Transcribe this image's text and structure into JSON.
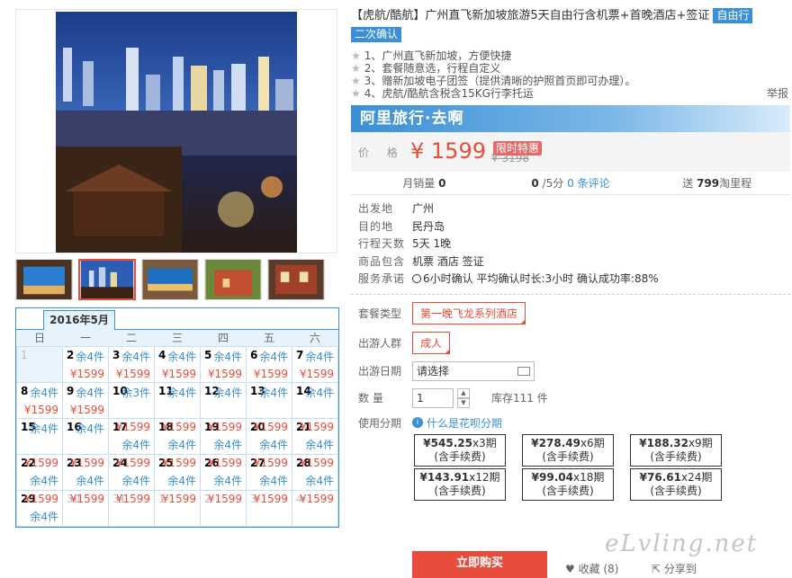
{
  "title": "【虎航/酷航】广州直飞新加坡旅游5天自由行含机票+首晚酒店+签证",
  "tag_free": "自由行",
  "tag_confirm": "二次确认",
  "features": [
    "1、广州直飞新加坡，方便快捷",
    "2、套餐随意选，行程自定义",
    "3、赠新加坡电子团签（提供清晰的护照首页即可办理）。",
    "4、虎航/酷航含税含15KG行李托运"
  ],
  "report": "举报",
  "brand": "阿里旅行·去啊",
  "price_label": "价 格",
  "price": "¥ 1599",
  "old_price": "¥ 3198",
  "special": "限时特惠",
  "stats": {
    "sales_label": "月销量",
    "sales": "0",
    "score": "0",
    "score_suffix": "/5分",
    "reviews": "0 条评论",
    "points_prefix": "送",
    "points": "799",
    "points_suffix": "淘里程"
  },
  "info": [
    {
      "k": "出发地",
      "v": "广州"
    },
    {
      "k": "目的地",
      "v": "民丹岛"
    },
    {
      "k": "行程天数",
      "v": "5天 1晚"
    },
    {
      "k": "商品包含",
      "v": "机票  酒店  签证"
    },
    {
      "k": "服务承诺",
      "v": "6小时确认   平均确认时长:3小时   确认成功率:88%"
    }
  ],
  "options": {
    "package_label": "套餐类型",
    "package": "第一晚飞龙系列酒店",
    "group_label": "出游人群",
    "group": "成人",
    "date_label": "出游日期",
    "date_placeholder": "请选择",
    "qty_label": "数  量",
    "qty": "1",
    "stock": "库存111 件",
    "install_label": "使用分期",
    "install_link": "什么是花呗分期"
  },
  "installments": [
    {
      "amt": "¥545.25",
      "n": "x3期",
      "fee": "(含手续费)"
    },
    {
      "amt": "¥278.49",
      "n": "x6期",
      "fee": "(含手续费)"
    },
    {
      "amt": "¥188.32",
      "n": "x9期",
      "fee": "(含手续费)"
    },
    {
      "amt": "¥143.91",
      "n": "x12期",
      "fee": "(含手续费)"
    },
    {
      "amt": "¥99.04",
      "n": "x18期",
      "fee": "(含手续费)"
    },
    {
      "amt": "¥76.61",
      "n": "x24期",
      "fee": "(含手续费)"
    }
  ],
  "buy": "立即购买",
  "fav": "收藏 (8)",
  "share": "分享到",
  "watermark": "eLvling.net",
  "calendar": {
    "month": "2016年5月",
    "weekdays": [
      "日",
      "一",
      "二",
      "三",
      "四",
      "五",
      "六"
    ],
    "rows": [
      [
        [
          "1",
          "",
          "",
          ""
        ],
        [
          "2",
          "余4件",
          "¥1599",
          ""
        ],
        [
          "3",
          "余4件",
          "¥1599",
          ""
        ],
        [
          "4",
          "余4件",
          "¥1599",
          ""
        ],
        [
          "5",
          "余4件",
          "¥1599",
          ""
        ],
        [
          "6",
          "余4件",
          "¥1599",
          ""
        ],
        [
          "7",
          "余4件",
          "¥1599",
          ""
        ]
      ],
      [
        [
          "8",
          "余4件",
          "¥1599",
          ""
        ],
        [
          "9",
          "余4件",
          "¥1599",
          ""
        ],
        [
          "10",
          "余3件",
          "",
          ""
        ],
        [
          "11",
          "余4件",
          "",
          ""
        ],
        [
          "12",
          "余4件",
          "",
          ""
        ],
        [
          "13",
          "余4件",
          "",
          ""
        ],
        [
          "14",
          "余4件",
          "",
          ""
        ]
      ],
      [
        [
          "15",
          "余4件",
          "",
          ""
        ],
        [
          "16",
          "余4件",
          "",
          ""
        ],
        [
          "17",
          "余4件",
          "¥1599",
          "t"
        ],
        [
          "18",
          "余4件",
          "¥1599",
          "t"
        ],
        [
          "19",
          "余4件",
          "¥1599",
          "t"
        ],
        [
          "20",
          "余4件",
          "¥1599",
          "t"
        ],
        [
          "21",
          "余4件",
          "¥1599",
          "t"
        ]
      ],
      [
        [
          "22",
          "余4件",
          "¥1599",
          "t"
        ],
        [
          "23",
          "余4件",
          "¥1599",
          "t"
        ],
        [
          "24",
          "余4件",
          "¥1599",
          "t"
        ],
        [
          "25",
          "余4件",
          "¥1599",
          "t"
        ],
        [
          "26",
          "余4件",
          "¥1599",
          "t"
        ],
        [
          "27",
          "余4件",
          "¥1599",
          "t"
        ],
        [
          "28",
          "余4件",
          "¥1599",
          "t"
        ]
      ],
      [
        [
          "29",
          "余4件",
          "¥1599",
          "t"
        ],
        [
          "30",
          "",
          "¥1599",
          "g"
        ],
        [
          "31",
          "",
          "¥1599",
          "g"
        ],
        [
          "1",
          "",
          "¥1599",
          "g"
        ],
        [
          "2",
          "",
          "¥1599",
          "g"
        ],
        [
          "3",
          "",
          "¥1599",
          "g"
        ],
        [
          "4",
          "",
          "¥1599",
          "g"
        ]
      ]
    ]
  }
}
